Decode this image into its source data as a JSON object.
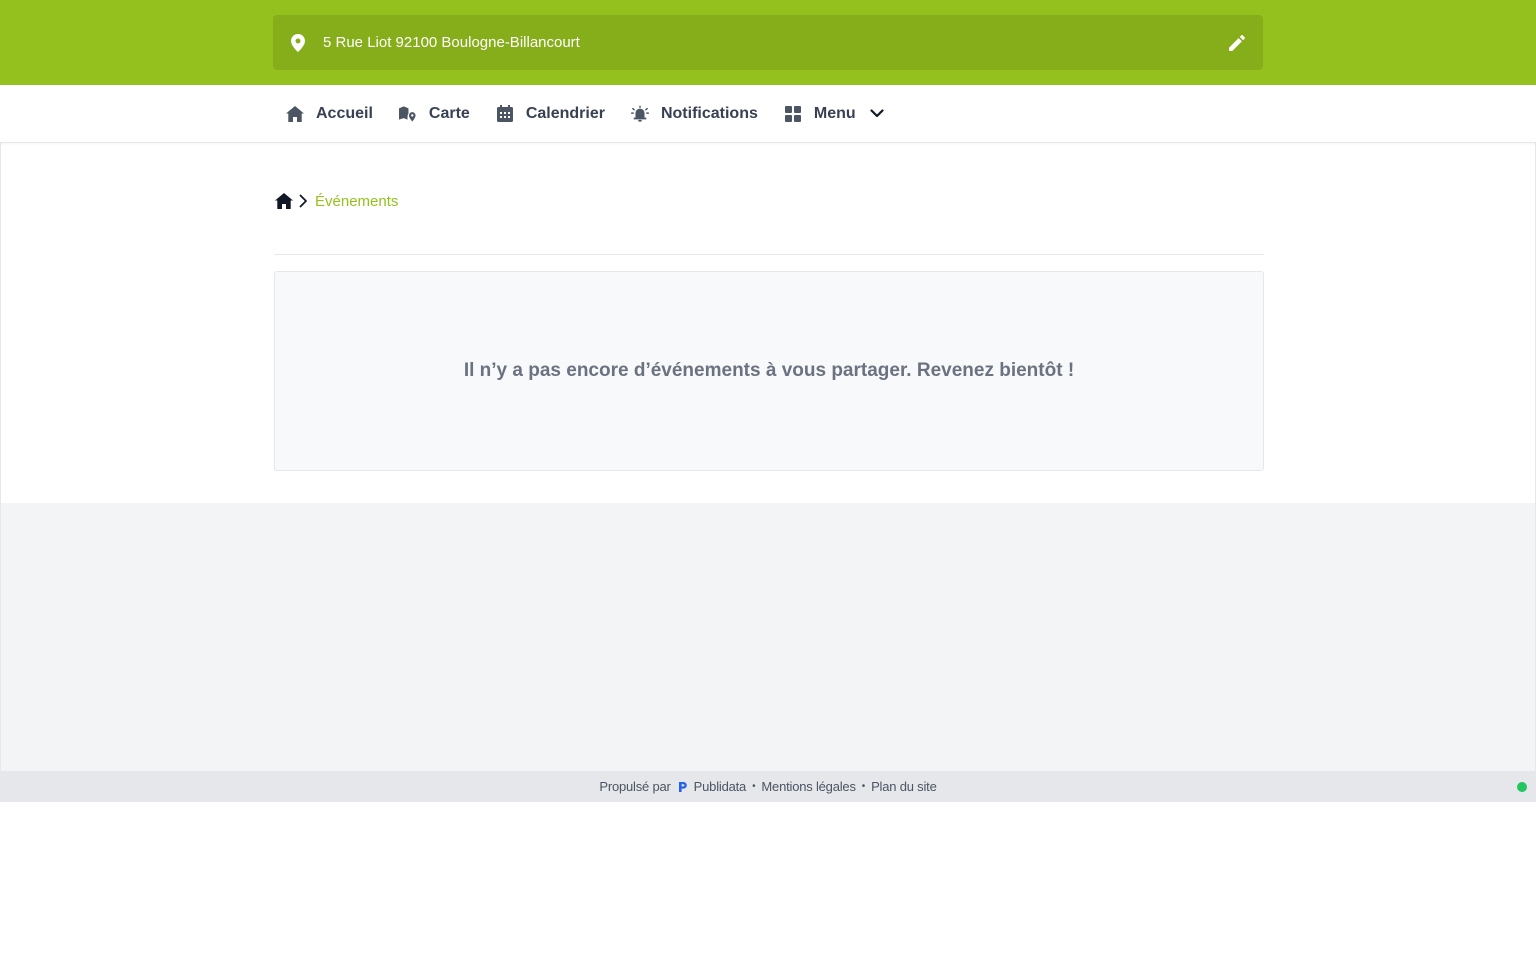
{
  "colors": {
    "accent": "#95c11f",
    "accent_dark": "#86ad1a",
    "text": "#374151",
    "muted": "#6b7280",
    "status": "#22c55e"
  },
  "header": {
    "address": "5 Rue Liot 92100 Boulogne-Billancourt",
    "icons": {
      "location": "map-pin-icon",
      "edit": "pencil-icon"
    }
  },
  "nav": {
    "items": [
      {
        "label": "Accueil",
        "icon": "home-icon"
      },
      {
        "label": "Carte",
        "icon": "map-icon"
      },
      {
        "label": "Calendrier",
        "icon": "calendar-icon"
      },
      {
        "label": "Notifications",
        "icon": "alarm-bell-icon"
      },
      {
        "label": "Menu",
        "icon": "grid-icon"
      }
    ]
  },
  "breadcrumb": {
    "current": "Événements"
  },
  "main": {
    "empty_message": "Il n’y a pas encore d’événements à vous partager. Revenez bientôt !"
  },
  "footer": {
    "powered_by": "Propulsé par",
    "brand": "Publidata",
    "legal": "Mentions légales",
    "sitemap": "Plan du site"
  }
}
